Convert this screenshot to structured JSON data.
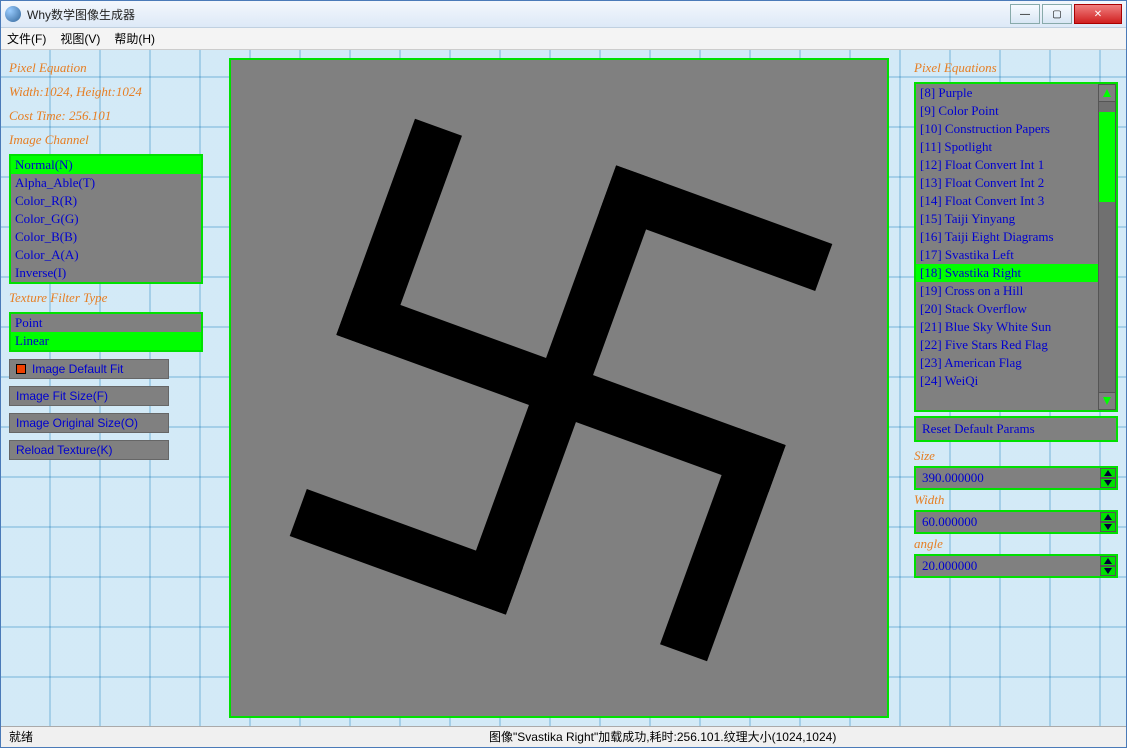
{
  "window": {
    "title": "Why数学图像生成器"
  },
  "menu": {
    "file": "文件(F)",
    "view": "视图(V)",
    "help": "帮助(H)"
  },
  "left": {
    "heading1": "Pixel Equation",
    "dimensions": "Width:1024, Height:1024",
    "cost": "Cost Time: 256.101",
    "channel_label": "Image Channel",
    "channels": [
      "Normal(N)",
      "Alpha_Able(T)",
      "Color_R(R)",
      "Color_G(G)",
      "Color_B(B)",
      "Color_A(A)",
      "Inverse(I)"
    ],
    "channel_selected": 0,
    "filter_label": "Texture Filter Type",
    "filters": [
      "Point",
      "Linear"
    ],
    "filter_selected": 1,
    "btn_default_fit": "Image Default Fit",
    "btn_fit_size": "Image Fit Size(F)",
    "btn_original": "Image Original Size(O)",
    "btn_reload": "Reload Texture(K)"
  },
  "right": {
    "heading": "Pixel Equations",
    "items": [
      "[8] Purple",
      "[9] Color Point",
      "[10] Construction Papers",
      "[11] Spotlight",
      "[12] Float Convert Int 1",
      "[13] Float Convert Int 2",
      "[14] Float Convert Int 3",
      "[15] Taiji Yinyang",
      "[16] Taiji Eight Diagrams",
      "[17] Svastika Left",
      "[18] Svastika Right",
      "[19] Cross on a Hill",
      "[20] Stack Overflow",
      "[21] Blue Sky White Sun",
      "[22] Five Stars Red Flag",
      "[23] American Flag",
      "[24] WeiQi"
    ],
    "selected_index": 10,
    "reset_btn": "Reset Default Params",
    "params": [
      {
        "label": "Size",
        "value": "390.000000"
      },
      {
        "label": "Width",
        "value": "60.000000"
      },
      {
        "label": "angle",
        "value": "20.000000"
      }
    ]
  },
  "status": {
    "ready": "就绪",
    "msg": "图像\"Svastika Right\"加载成功,耗时:256.101.纹理大小(1024,1024)"
  }
}
